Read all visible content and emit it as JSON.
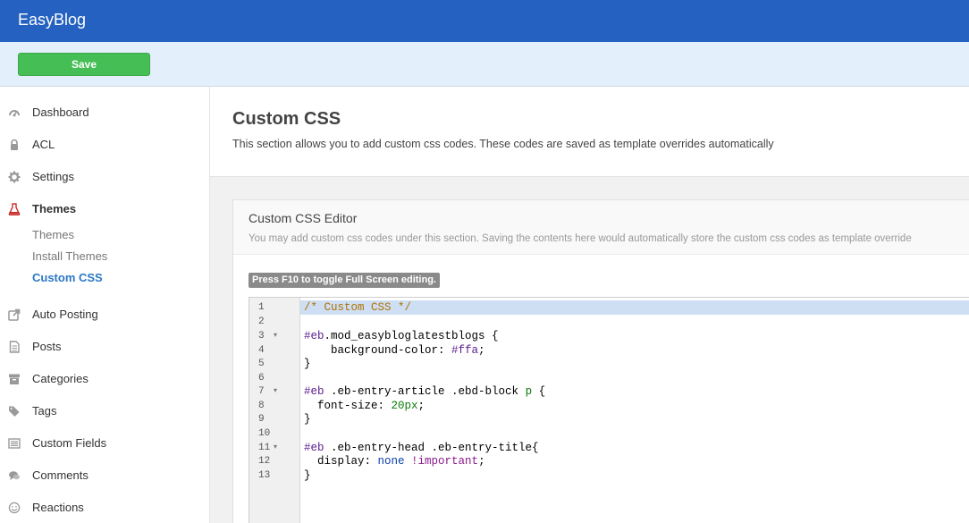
{
  "app": {
    "title": "EasyBlog"
  },
  "toolbar": {
    "save_label": "Save"
  },
  "sidebar": {
    "items": [
      {
        "label": "Dashboard",
        "icon": "dashboard-icon"
      },
      {
        "label": "ACL",
        "icon": "lock-icon"
      },
      {
        "label": "Settings",
        "icon": "gear-icon"
      },
      {
        "label": "Themes",
        "icon": "flask-icon",
        "active": true
      },
      {
        "label": "Auto Posting",
        "icon": "share-icon"
      },
      {
        "label": "Posts",
        "icon": "document-icon"
      },
      {
        "label": "Categories",
        "icon": "archive-icon"
      },
      {
        "label": "Tags",
        "icon": "tags-icon"
      },
      {
        "label": "Custom Fields",
        "icon": "list-icon"
      },
      {
        "label": "Comments",
        "icon": "comments-icon"
      },
      {
        "label": "Reactions",
        "icon": "smile-icon"
      }
    ],
    "themes_subitems": [
      {
        "label": "Themes"
      },
      {
        "label": "Install Themes"
      },
      {
        "label": "Custom CSS",
        "active": true
      }
    ]
  },
  "page": {
    "title": "Custom CSS",
    "description": "This section allows you to add custom css codes. These codes are saved as template overrides automatically"
  },
  "panel": {
    "title": "Custom CSS Editor",
    "description": "You may add custom css codes under this section. Saving the contents here would automatically store the custom css codes as template override"
  },
  "editor": {
    "hint": "Press F10 to toggle Full Screen editing.",
    "line_numbers": [
      "1",
      "2",
      "3",
      "4",
      "5",
      "6",
      "7",
      "8",
      "9",
      "10",
      "11",
      "12",
      "13"
    ],
    "fold_markers": {
      "3": "▾",
      "7": "▾",
      "11": "▾"
    },
    "code": {
      "l1": "/* Custom CSS */",
      "l3_id": "#eb",
      "l3_rest": ".mod_easybloglatestblogs {",
      "l4_prop": "    background-color: ",
      "l4_val": "#ffa",
      "l4_end": ";",
      "l5": "}",
      "l7_id": "#eb",
      "l7_mid": " .eb-entry-article .ebd-block ",
      "l7_tag": "p",
      "l7_end": " {",
      "l8_prop": "  font-size: ",
      "l8_val": "20px",
      "l8_end": ";",
      "l9": "}",
      "l11_id": "#eb",
      "l11_rest": " .eb-entry-head .eb-entry-title{",
      "l12_prop": "  display: ",
      "l12_val": "none",
      "l12_sp": " ",
      "l12_kw": "!important",
      "l12_end": ";",
      "l13": "}"
    }
  }
}
